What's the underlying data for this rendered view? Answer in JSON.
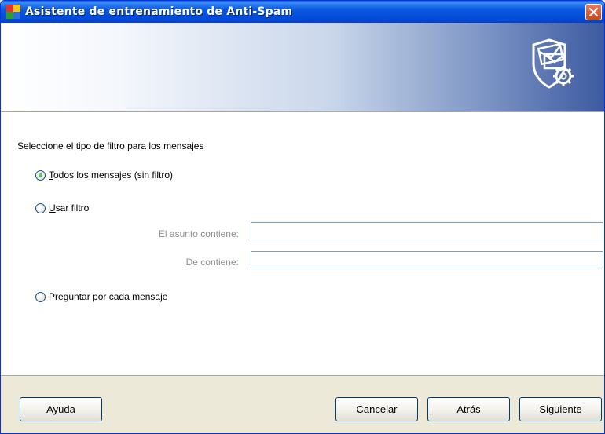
{
  "window": {
    "title": "Asistente de entrenamiento de Anti-Spam",
    "app_icon": "avg-logo-icon",
    "close_icon": "close-icon",
    "banner_icon": "shield-mail-gear-icon"
  },
  "content": {
    "prompt": "Seleccione el tipo de filtro para los mensajes",
    "options": [
      {
        "label_first": "T",
        "label_rest": "odos los mensajes (sin filtro)",
        "checked": true
      },
      {
        "label_first": "U",
        "label_rest": "sar filtro",
        "checked": false
      },
      {
        "label_first": "P",
        "label_rest": "reguntar por cada mensaje",
        "checked": false
      }
    ],
    "filter_fields": {
      "subject_label": "El asunto contiene:",
      "subject_value": "",
      "from_label": "De contiene:",
      "from_value": ""
    }
  },
  "buttons": {
    "help": {
      "first": "A",
      "rest": "yuda"
    },
    "cancel": {
      "first": "",
      "rest": "Cancelar"
    },
    "back": {
      "first": "A",
      "rest": "trás"
    },
    "next": {
      "first": "S",
      "rest": "iguiente"
    }
  },
  "colors": {
    "titlebar": "#0349d6",
    "radio_checked": "#1f9a1f",
    "field_label": "#8e8e8e"
  }
}
